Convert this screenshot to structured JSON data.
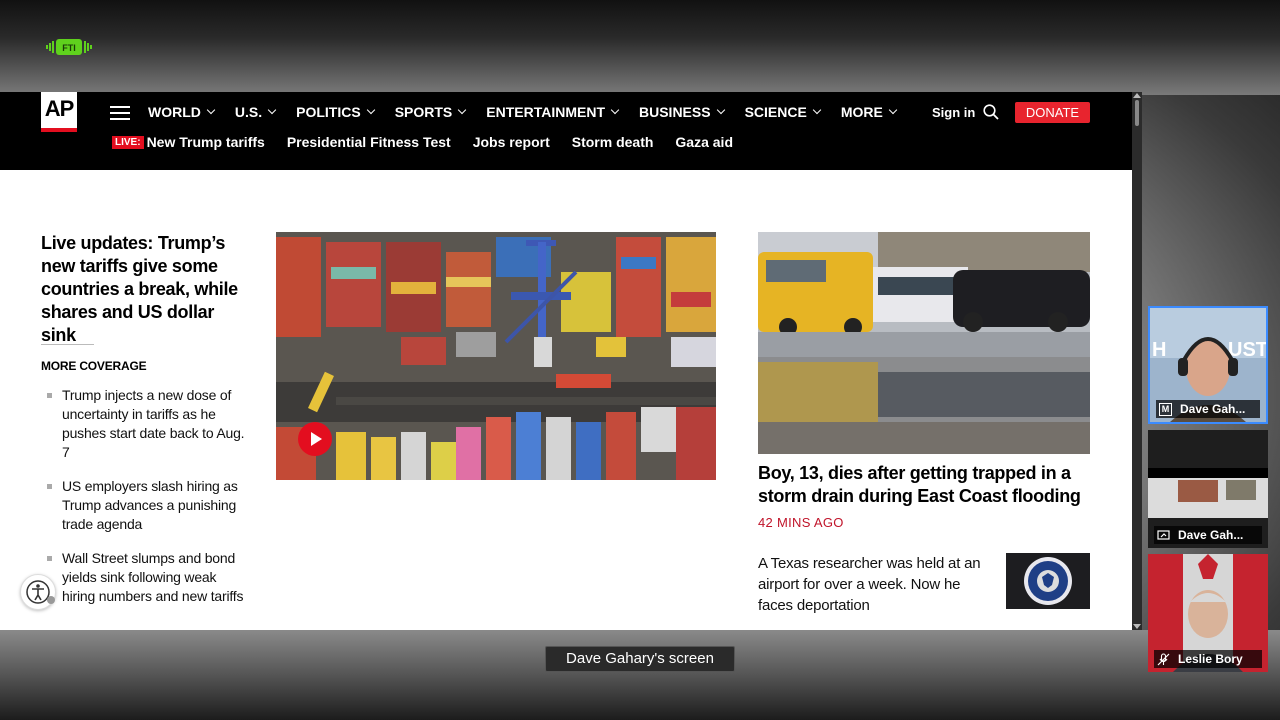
{
  "header": {
    "logo": "AP",
    "nav": [
      "WORLD",
      "U.S.",
      "POLITICS",
      "SPORTS",
      "ENTERTAINMENT",
      "BUSINESS",
      "SCIENCE",
      "MORE"
    ],
    "sign_in": "Sign in",
    "donate": "DONATE",
    "live_badge": "LIVE:",
    "trending": [
      "New Trump tariffs",
      "Presidential Fitness Test",
      "Jobs report",
      "Storm death",
      "Gaza aid"
    ]
  },
  "main": {
    "lead_headline": "Live updates: Trump’s new tariffs give some countries a break, while shares and US dollar sink",
    "more_coverage_label": "MORE COVERAGE",
    "coverage": [
      "Trump injects a new dose of uncertainty in tariffs as he pushes start date back to Aug. 7",
      "US employers slash hiring as Trump advances a punishing trade agenda",
      "Wall Street slumps and bond yields sink following weak hiring numbers and new tariffs"
    ],
    "side_headline": "Boy, 13, dies after getting trapped in a storm drain during East Coast flooding",
    "side_time": "42 MINS AGO",
    "story2": "A Texas researcher was held at an airport for over a week. Now he faces deportation"
  },
  "participants": [
    {
      "name": "Dave Gah...",
      "icon": "m-icon"
    },
    {
      "name": "Dave Gah...",
      "icon": "screen-share-icon"
    },
    {
      "name": "Leslie Bory",
      "icon": "mic-muted-icon"
    }
  ],
  "caption": "Dave Gahary's screen",
  "colors": {
    "accent_red": "#e30e1f",
    "active_border": "#3b8bff",
    "time_red": "#c0142a"
  }
}
